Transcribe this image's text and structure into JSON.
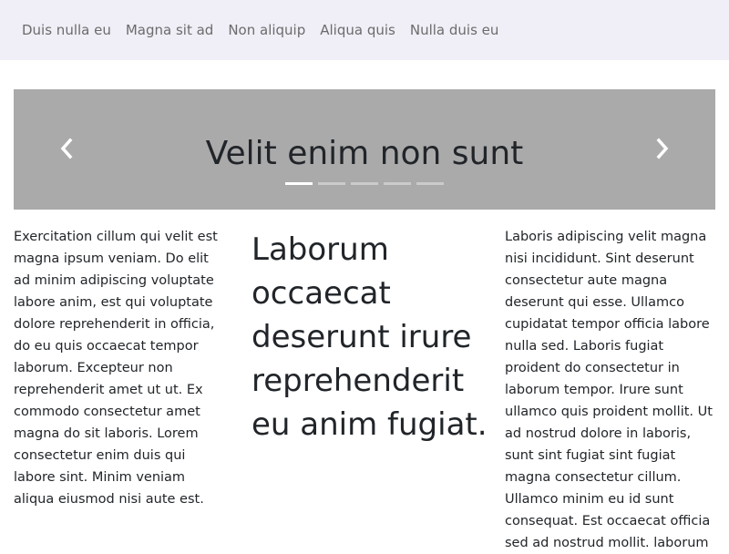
{
  "nav": {
    "links": [
      "Duis nulla eu",
      "Magna sit ad",
      "Non aliquip",
      "Aliqua quis",
      "Nulla duis eu"
    ]
  },
  "carousel": {
    "title": "Velit enim non sunt",
    "indicator_count": 5,
    "active_index": 0,
    "prev_icon": "chevron-left-icon",
    "next_icon": "chevron-right-icon",
    "background": "#aaaaaa"
  },
  "content": {
    "left_text": "Exercitation cillum qui velit est magna ipsum veniam. Do elit ad minim adipiscing voluptate labore anim, est qui voluptate dolore reprehenderit in officia, do eu quis occaecat tempor laborum. Excepteur non reprehenderit amet ut ut. Ex commodo consectetur amet magna do sit laboris. Lorem consectetur enim duis qui labore sint. Minim veniam aliqua eiusmod nisi aute est.",
    "mid_heading": "Laborum occaecat deserunt irure reprehenderit eu anim fugiat.",
    "right_text": "Laboris adipiscing velit magna nisi incididunt. Sint deserunt consectetur aute magna deserunt qui esse. Ullamco cupidatat tempor officia labore nulla sed. Laboris fugiat proident do consectetur in laborum tempor. Irure sunt ullamco quis proident mollit. Ut ad nostrud dolore in laboris, sunt sint fugiat sint fugiat magna consectetur cillum. Ullamco minim eu id sunt consequat. Est occaecat officia sed ad nostrud mollit. laborum"
  }
}
